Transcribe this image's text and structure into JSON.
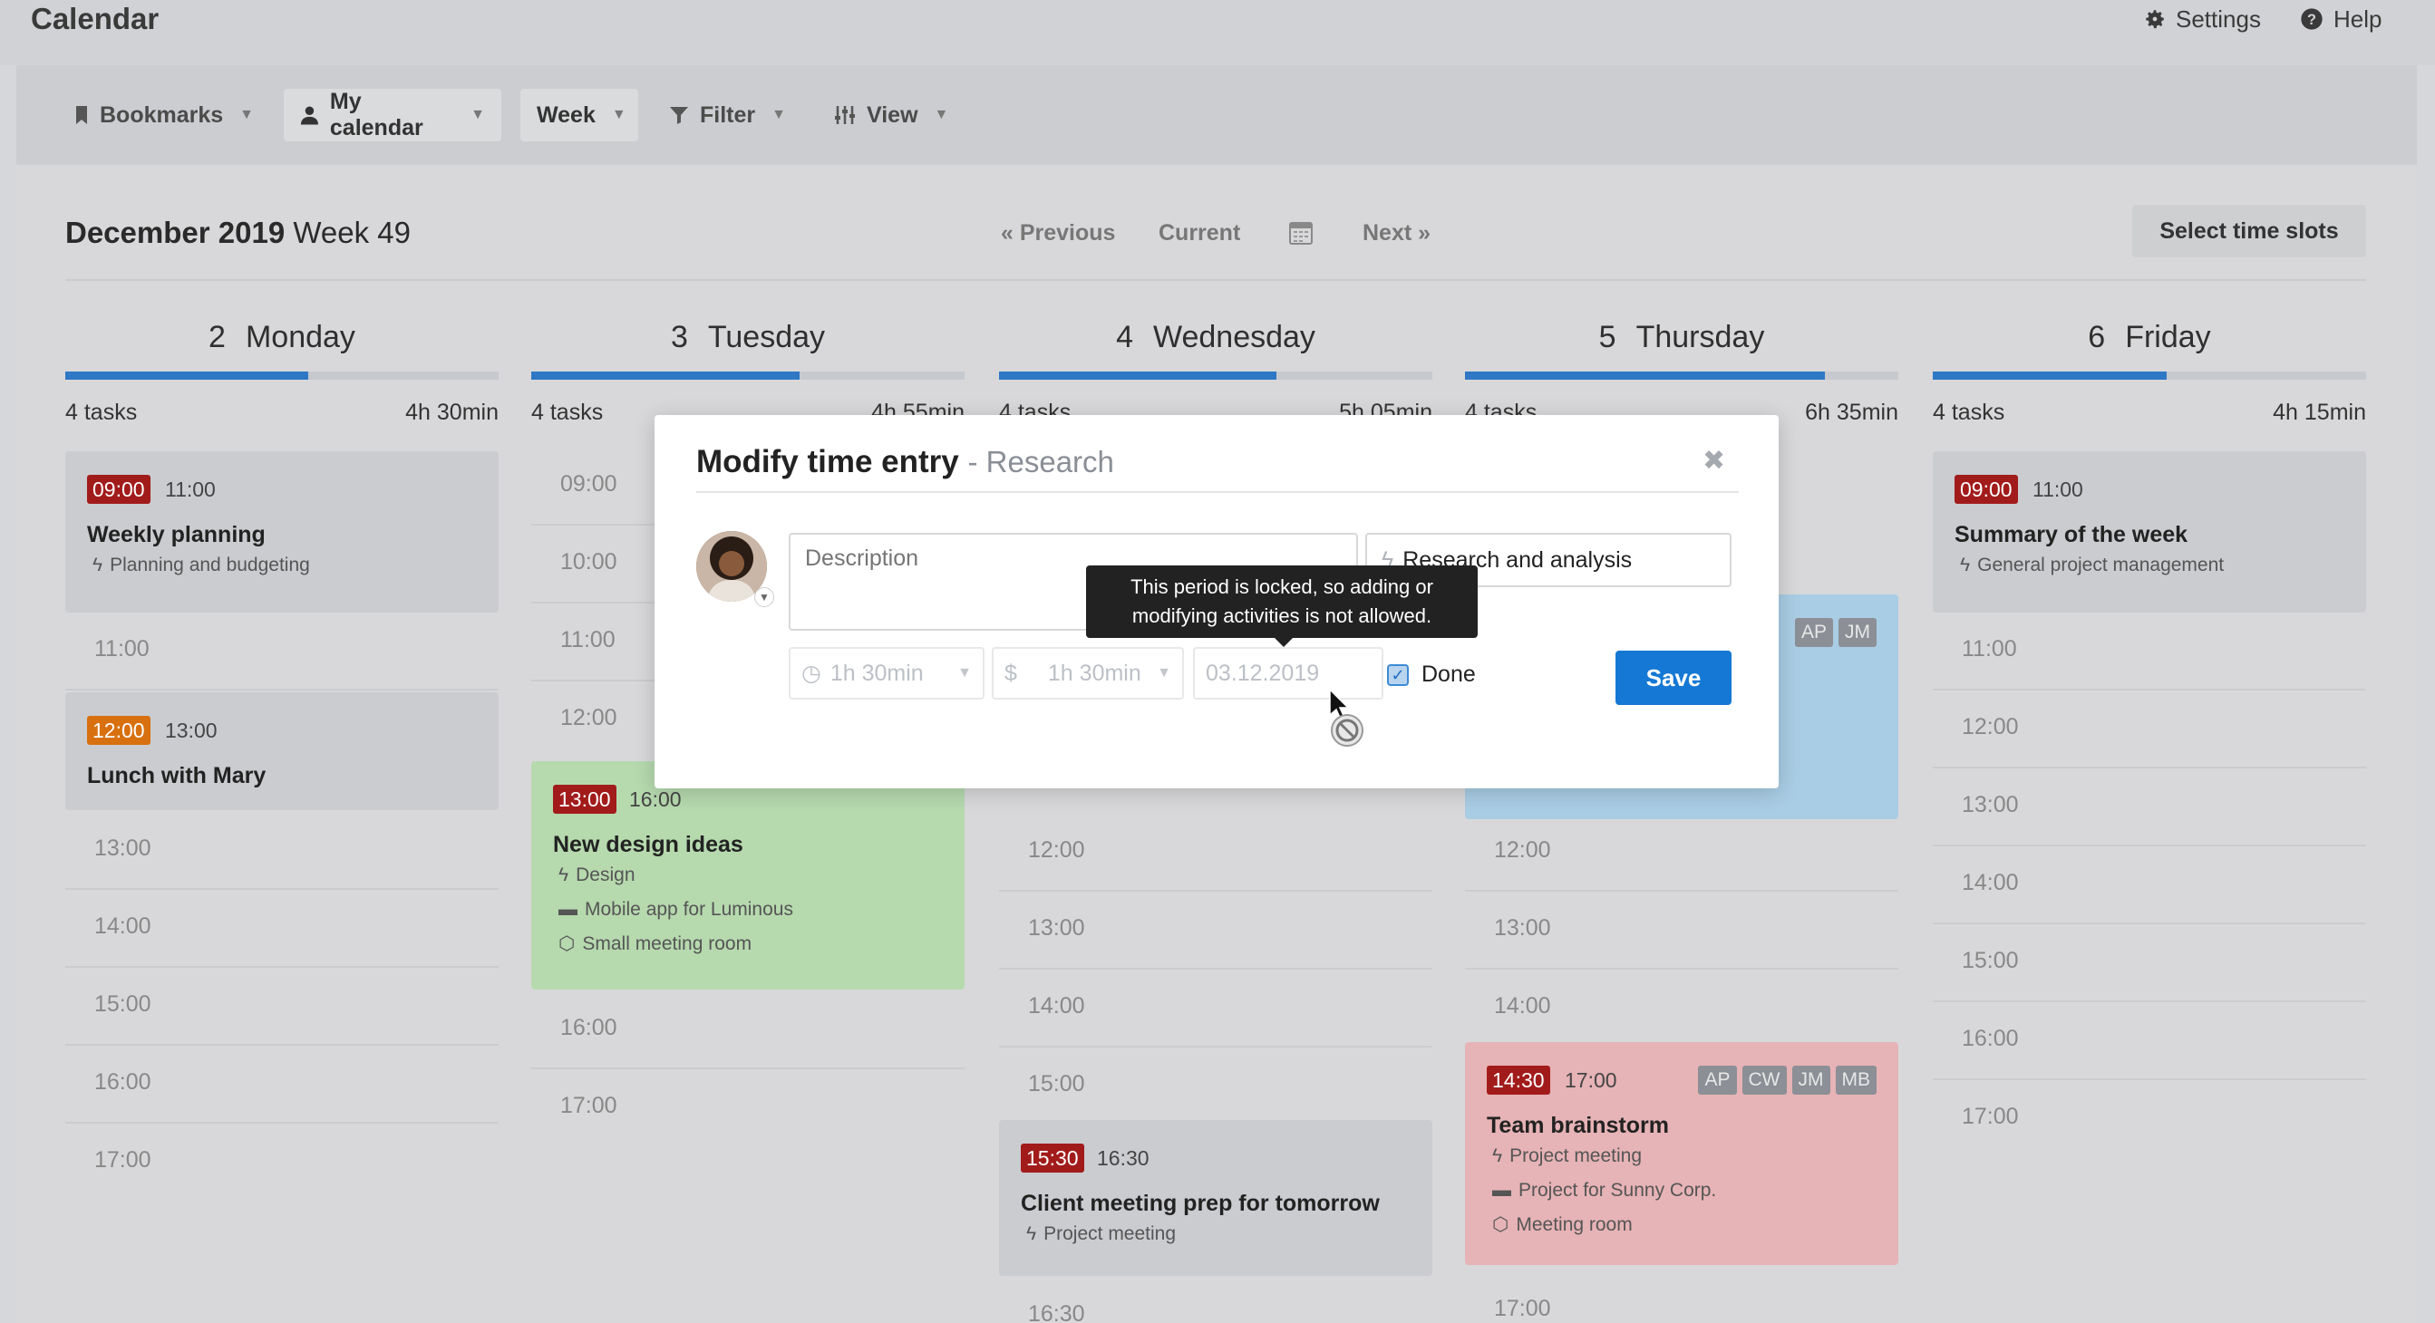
{
  "app": {
    "title": "Calendar",
    "settings_label": "Settings",
    "help_label": "Help"
  },
  "toolbar": {
    "bookmarks": "Bookmarks",
    "my_calendar": "My calendar",
    "week": "Week",
    "filter": "Filter",
    "view": "View"
  },
  "period": {
    "month_year": "December 2019",
    "week": "Week 49"
  },
  "nav": {
    "previous": "« Previous",
    "current": "Current",
    "next": "Next »",
    "select_slots": "Select time slots"
  },
  "colors": {
    "accent": "#1478d4",
    "progress": "#2e78c5",
    "red_badge": "#a21b1b",
    "orange_badge": "#d8700f"
  },
  "days": [
    {
      "num": "2",
      "name": "Monday",
      "tasks": "4 tasks",
      "time": "4h 30min",
      "progress": 0.56
    },
    {
      "num": "3",
      "name": "Tuesday",
      "tasks": "4 tasks",
      "time": "4h 55min",
      "progress": 0.62
    },
    {
      "num": "4",
      "name": "Wednesday",
      "tasks": "4 tasks",
      "time": "5h 05min",
      "progress": 0.64
    },
    {
      "num": "5",
      "name": "Thursday",
      "tasks": "4 tasks",
      "time": "6h 35min",
      "progress": 0.83
    },
    {
      "num": "6",
      "name": "Friday",
      "tasks": "4 tasks",
      "time": "4h 15min",
      "progress": 0.54
    }
  ],
  "monday": {
    "ev1": {
      "start": "09:00",
      "end": "11:00",
      "title": "Weekly planning",
      "activity": "Planning and budgeting"
    },
    "ev2": {
      "start": "12:00",
      "end": "13:00",
      "title": "Lunch with Mary"
    },
    "slots": [
      "11:00",
      "13:00",
      "14:00",
      "15:00",
      "16:00",
      "17:00"
    ]
  },
  "tuesday": {
    "slots": [
      "09:00",
      "10:00",
      "11:00",
      "12:00",
      "16:00",
      "17:00"
    ],
    "ev1": {
      "start": "13:00",
      "end": "16:00",
      "title": "New design ideas",
      "activity": "Design",
      "project": "Mobile app for Luminous",
      "room": "Small meeting room"
    }
  },
  "wednesday": {
    "slots": [
      "12:00",
      "13:00",
      "14:00",
      "15:00",
      "16:30"
    ],
    "ev1": {
      "start": "15:30",
      "end": "16:30",
      "title": "Client meeting prep for tomorrow",
      "activity": "Project meeting"
    }
  },
  "thursday": {
    "ev_top": {
      "chips": [
        "AP",
        "JM"
      ]
    },
    "slots": [
      "12:00",
      "13:00",
      "14:00",
      "17:00"
    ],
    "ev2": {
      "start": "14:30",
      "end": "17:00",
      "title": "Team brainstorm",
      "activity": "Project meeting",
      "project": "Project for Sunny Corp.",
      "room": "Meeting room",
      "chips": [
        "AP",
        "CW",
        "JM",
        "MB"
      ]
    }
  },
  "friday": {
    "ev1": {
      "start": "09:00",
      "end": "11:00",
      "title": "Summary of the week",
      "activity": "General project management"
    },
    "slots": [
      "11:00",
      "12:00",
      "13:00",
      "14:00",
      "15:00",
      "16:00",
      "17:00"
    ]
  },
  "modal": {
    "title": "Modify time entry",
    "subtitle": "- Research",
    "description_placeholder": "Description",
    "activity": "Research and analysis",
    "duration": "1h 30min",
    "billable_symbol": "$",
    "billable": "1h 30min",
    "date": "03.12.2019",
    "done_label": "Done",
    "done_checked": true,
    "save": "Save"
  },
  "tooltip": {
    "line1": "This period is locked, so adding or",
    "line2": "modifying activities is not allowed."
  }
}
